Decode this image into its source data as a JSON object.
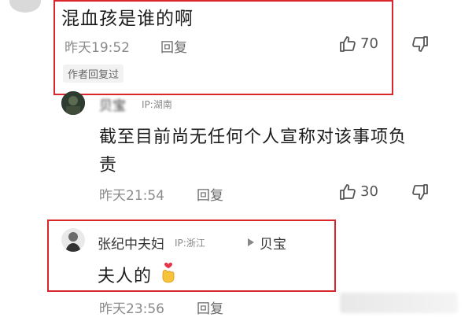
{
  "top_avatar": {
    "desc": "avatar"
  },
  "comment1": {
    "text": "混血孩是谁的啊",
    "time": "昨天19:52",
    "reply_label": "回复",
    "like_count": "70",
    "author_tag": "作者回复过"
  },
  "comment2": {
    "user": "贝宝",
    "ip": "IP:湖南",
    "text_line1": "截至目前尚无任何个人宣称对该事项负",
    "text_line2": "责",
    "time": "昨天21:54",
    "reply_label": "回复",
    "like_count": "30"
  },
  "comment3": {
    "user": "张纪中夫妇",
    "ip": "IP:浙江",
    "reply_to": "贝宝",
    "text": "夫人的",
    "time": "昨天23:56",
    "reply_label": "回复"
  },
  "colors": {
    "highlight_border": "#d8262c",
    "text_main": "#1c1c1c",
    "text_meta": "#8a8a8a"
  },
  "icons": [
    "thumb-up-icon",
    "thumb-down-icon",
    "play-triangle-icon",
    "heart-hand-emoji"
  ]
}
